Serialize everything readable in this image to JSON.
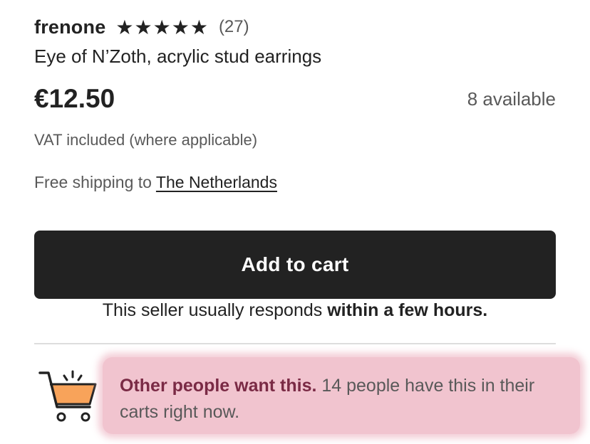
{
  "shop": {
    "name": "frenone",
    "rating_stars": "★★★★★",
    "rating_value": 5,
    "review_count": "(27)"
  },
  "listing": {
    "title": "Eye of N’Zoth, acrylic stud earrings",
    "price": "€12.50",
    "availability": "8 available",
    "vat_note": "VAT included (where applicable)",
    "shipping_prefix": "Free shipping to",
    "shipping_country": "The Netherlands"
  },
  "actions": {
    "add_to_cart_label": "Add to cart"
  },
  "seller": {
    "responds_prefix": "This seller usually responds ",
    "responds_strong": "within a few hours."
  },
  "promo": {
    "icon": "shopping-cart-icon",
    "strong": "Other people want this.",
    "text": " 14 people have this in their carts right now."
  },
  "colors": {
    "button_bg": "#222222",
    "highlight_bg": "#f1c4cf",
    "promo_strong": "#7a2a45",
    "cart_fill": "#f8a35a"
  }
}
